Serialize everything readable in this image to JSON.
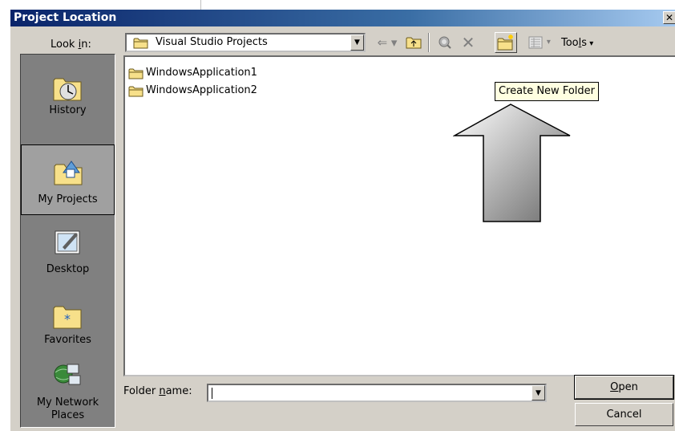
{
  "dialog": {
    "title": "Project Location",
    "close_symbol": "✕"
  },
  "lookin": {
    "label_pre": "Look ",
    "label_accel": "i",
    "label_post": "n:",
    "value": "Visual Studio Projects",
    "icon": "folder-icon"
  },
  "toolbar": {
    "back_icon": "back-arrow-icon",
    "up_icon": "up-one-level-icon",
    "search_icon": "search-web-icon",
    "delete_icon": "delete-icon",
    "new_folder_icon": "new-folder-icon",
    "views_icon": "views-icon",
    "tools_pre": "Too",
    "tools_accel": "l",
    "tools_post": "s"
  },
  "places": [
    {
      "label": "History",
      "icon": "history-icon"
    },
    {
      "label": "My Projects",
      "icon": "my-projects-icon",
      "selected": true
    },
    {
      "label": "Desktop",
      "icon": "desktop-icon"
    },
    {
      "label": "Favorites",
      "icon": "favorites-icon"
    },
    {
      "label_line1": "My Network",
      "label_line2": "Places",
      "icon": "network-places-icon"
    }
  ],
  "files": [
    {
      "name": "WindowsApplication1",
      "icon": "folder-icon"
    },
    {
      "name": "WindowsApplication2",
      "icon": "folder-icon"
    }
  ],
  "tooltip": "Create New Folder",
  "folder_name": {
    "label_pre": "Folder ",
    "label_accel": "n",
    "label_post": "ame:",
    "value": ""
  },
  "buttons": {
    "open_accel": "O",
    "open_post": "pen",
    "cancel": "Cancel"
  },
  "colors": {
    "title_gradient_start": "#0a246a",
    "dialog_face": "#d4d0c8",
    "tooltip_bg": "#ffffe1"
  }
}
